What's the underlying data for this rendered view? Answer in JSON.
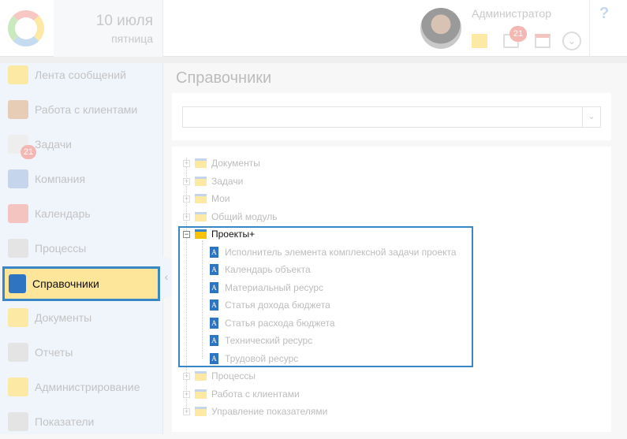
{
  "header": {
    "date": "10 июля",
    "weekday": "пятница",
    "user": "Администратор",
    "tasks_badge": "21",
    "help": "?",
    "dropdown": "⌄"
  },
  "sidebar": {
    "items": [
      {
        "label": "Лента сообщений",
        "icon": "mail-feed-icon",
        "color": "#fbe9a4"
      },
      {
        "label": "Работа с клиентами",
        "icon": "client-icon",
        "color": "#e8cdb6"
      },
      {
        "label": "Задачи",
        "icon": "tasks-icon",
        "color": "#eeeeee"
      },
      {
        "label": "Компания",
        "icon": "org-chart-icon",
        "color": "#c5d6ec"
      },
      {
        "label": "Календарь",
        "icon": "calendar-icon",
        "color": "#f4c4c0"
      },
      {
        "label": "Процессы",
        "icon": "process-icon",
        "color": "#e4e4e4"
      },
      {
        "label": "Справочники",
        "icon": "dictionary-book-icon",
        "color": "#2e74c0"
      },
      {
        "label": "Документы",
        "icon": "folder-icon",
        "color": "#fbe9a4"
      },
      {
        "label": "Отчеты",
        "icon": "report-icon",
        "color": "#e4e4e4"
      },
      {
        "label": "Администрирование",
        "icon": "lock-icon",
        "color": "#fbe9a4"
      },
      {
        "label": "Показатели",
        "icon": "gauge-icon",
        "color": "#e4e4e4"
      }
    ],
    "tasks_badge": "21",
    "collapse": "‹"
  },
  "main": {
    "title": "Справочники",
    "search": {
      "value": "",
      "button": "⌄"
    },
    "tree": [
      {
        "label": "Документы",
        "type": "folder",
        "toggle": "+"
      },
      {
        "label": "Задачи",
        "type": "folder",
        "toggle": "+"
      },
      {
        "label": "Мои",
        "type": "folder",
        "toggle": "+"
      },
      {
        "label": "Общий модуль",
        "type": "folder",
        "toggle": "+"
      },
      {
        "label": "Проекты+",
        "type": "folder",
        "toggle": "−",
        "active": true
      },
      {
        "label": "Исполнитель элемента комплексной задачи проекта",
        "type": "book",
        "child": true
      },
      {
        "label": "Календарь объекта",
        "type": "book",
        "child": true
      },
      {
        "label": "Материальный ресурс",
        "type": "book",
        "child": true
      },
      {
        "label": "Статья дохода бюджета",
        "type": "book",
        "child": true
      },
      {
        "label": "Статья расхода бюджета",
        "type": "book",
        "child": true
      },
      {
        "label": "Технический ресурс",
        "type": "book",
        "child": true
      },
      {
        "label": "Трудовой ресурс",
        "type": "book",
        "child": true
      },
      {
        "label": "Процессы",
        "type": "folder",
        "toggle": "+"
      },
      {
        "label": "Работа с клиентами",
        "type": "folder",
        "toggle": "+"
      },
      {
        "label": "Управление показателями",
        "type": "folder",
        "toggle": "+"
      }
    ],
    "book_glyph": "A"
  }
}
